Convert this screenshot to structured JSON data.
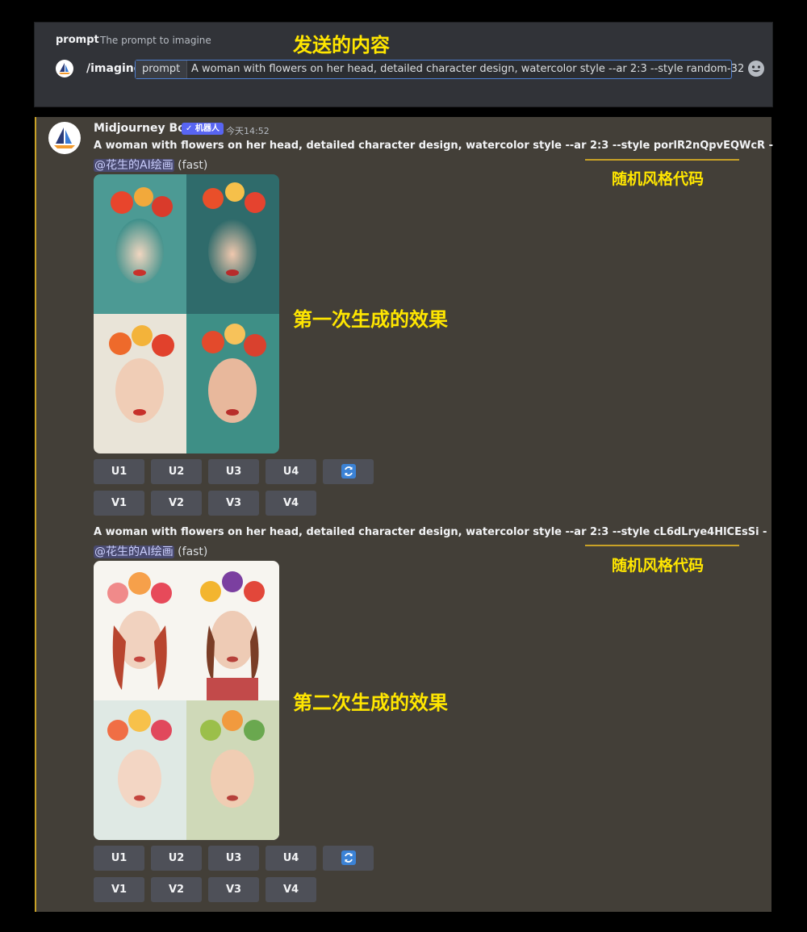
{
  "command_panel": {
    "option_name": "prompt",
    "option_description": "The prompt to imagine",
    "annotation": "发送的内容",
    "command": "/imagine",
    "field_label": "prompt",
    "field_value": "A woman with flowers on her head, detailed character design, watercolor style --ar 2:3 --style random-32"
  },
  "message": {
    "bot_name": "Midjourney Bot",
    "badge": "✓ 机器人",
    "timestamp": "今天14:52",
    "results": [
      {
        "prompt": "A woman with flowers on her head, detailed character design, watercolor style --ar 2:3 --style porlR2nQpvEQWcR -",
        "mention": "@花生的AI绘画",
        "speed": "(fast)",
        "code_annotation": "随机风格代码",
        "effect_annotation": "第一次生成的效果",
        "buttons_u": [
          "U1",
          "U2",
          "U3",
          "U4"
        ],
        "buttons_v": [
          "V1",
          "V2",
          "V3",
          "V4"
        ],
        "reroll_icon": "refresh-icon"
      },
      {
        "prompt": "A woman with flowers on her head, detailed character design, watercolor style --ar 2:3 --style cL6dLrye4HlCEsSi -",
        "mention": "@花生的AI绘画",
        "speed": "(fast)",
        "code_annotation": "随机风格代码",
        "effect_annotation": "第二次生成的效果",
        "buttons_u": [
          "U1",
          "U2",
          "U3",
          "U4"
        ],
        "buttons_v": [
          "V1",
          "V2",
          "V3",
          "V4"
        ],
        "reroll_icon": "refresh-icon"
      }
    ]
  },
  "colors": {
    "annotation": "#ffe600",
    "accent_bar": "#c9a227",
    "badge": "#5865f2"
  }
}
